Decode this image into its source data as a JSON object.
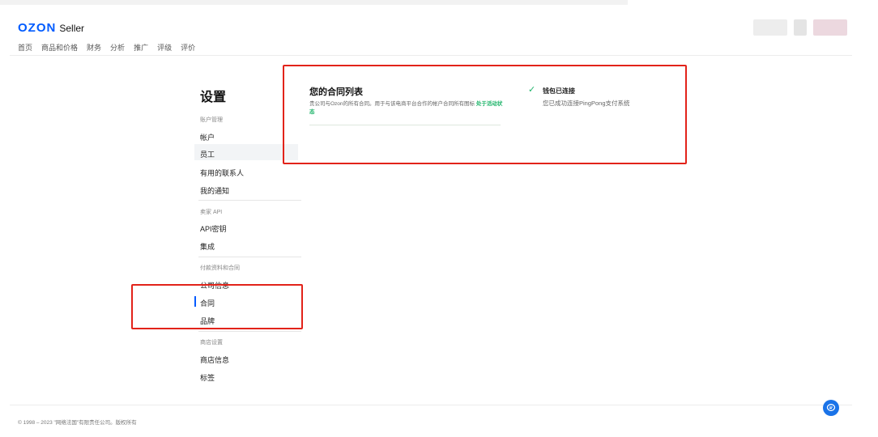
{
  "header": {
    "logo_brand": "OZON",
    "logo_suffix": "Seller",
    "nav": [
      "首页",
      "商品和价格",
      "财务",
      "分析",
      "推广",
      "评级",
      "评价"
    ]
  },
  "sidebar": {
    "title": "设置",
    "groups": [
      {
        "label": "账户管理",
        "items": [
          "帐户",
          "员工",
          "有用的联系人",
          "我的通知"
        ]
      },
      {
        "label": "卖家 API",
        "items": [
          "API密钥",
          "集成"
        ]
      },
      {
        "label": "付款资料和合同",
        "items": [
          "公司信息",
          "合同",
          "品牌"
        ]
      },
      {
        "label": "商店设置",
        "items": [
          "商店信息",
          "标签"
        ]
      }
    ]
  },
  "contracts": {
    "title": "您的合同列表",
    "description": "贵公司与Ozon的所有合同。用于与该电商平台合作的帐户合同所有图标",
    "link": "处于活动状态"
  },
  "wallet": {
    "title": "钱包已连接",
    "description": "您已成功连接PingPong支付系统"
  },
  "footer": {
    "copyright": "© 1998 – 2023 \"网络法国\"有限责任公司。版权所有"
  },
  "colors": {
    "brand": "#005bff",
    "success": "#1fb46a",
    "highlight": "#e2231a"
  },
  "icons": [
    "check-icon",
    "chat-icon"
  ]
}
